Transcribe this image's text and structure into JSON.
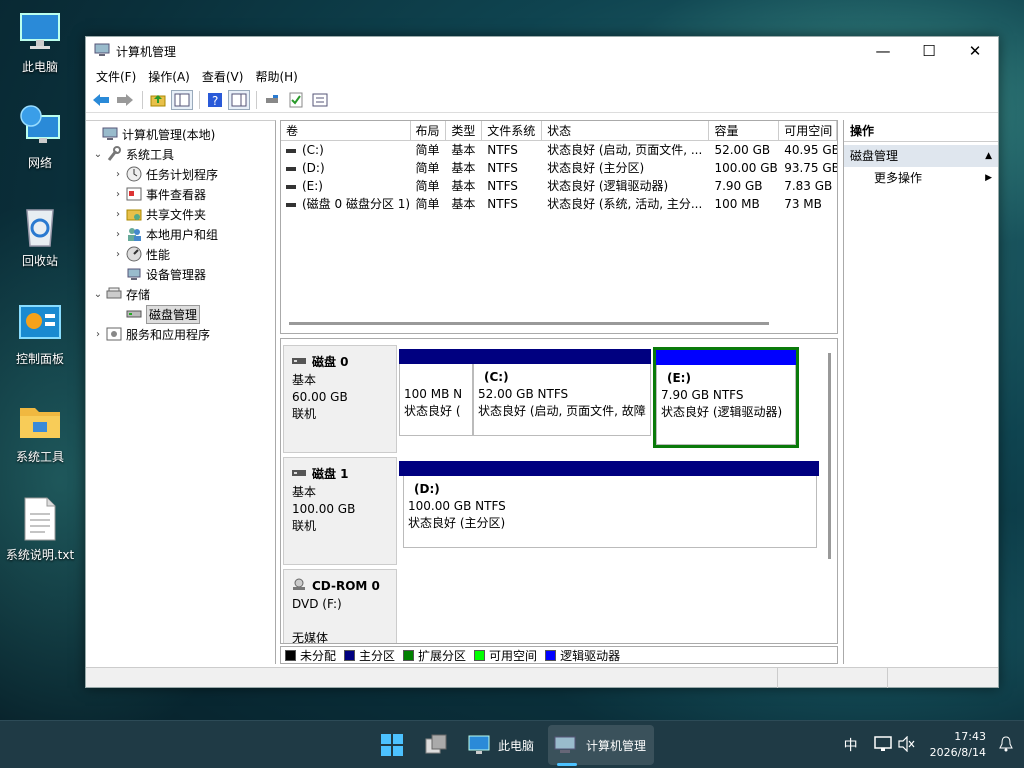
{
  "desktop": {
    "icons": [
      {
        "label": "此电脑"
      },
      {
        "label": "网络"
      },
      {
        "label": "回收站"
      },
      {
        "label": "控制面板"
      },
      {
        "label": "系统工具"
      },
      {
        "label": "系统说明.txt"
      }
    ]
  },
  "window": {
    "title": "计算机管理",
    "controls": {
      "minimize": "—",
      "maximize": "☐",
      "close": "✕"
    },
    "menu": [
      "文件(F)",
      "操作(A)",
      "查看(V)",
      "帮助(H)"
    ]
  },
  "tree": {
    "root": "计算机管理(本地)",
    "system_tools": "系统工具",
    "task_scheduler": "任务计划程序",
    "event_viewer": "事件查看器",
    "shared_folders": "共享文件夹",
    "local_users": "本地用户和组",
    "performance": "性能",
    "device_manager": "设备管理器",
    "storage": "存储",
    "disk_management": "磁盘管理",
    "services_apps": "服务和应用程序"
  },
  "volumes": {
    "headers": [
      "卷",
      "布局",
      "类型",
      "文件系统",
      "状态",
      "容量",
      "可用空间"
    ],
    "rows": [
      [
        "(C:)",
        "简单",
        "基本",
        "NTFS",
        "状态良好 (启动, 页面文件, ...",
        "52.00 GB",
        "40.95 GB"
      ],
      [
        "(D:)",
        "简单",
        "基本",
        "NTFS",
        "状态良好 (主分区)",
        "100.00 GB",
        "93.75 GB"
      ],
      [
        "(E:)",
        "简单",
        "基本",
        "NTFS",
        "状态良好 (逻辑驱动器)",
        "7.90 GB",
        "7.83 GB"
      ],
      [
        "(磁盘 0 磁盘分区 1)",
        "简单",
        "基本",
        "NTFS",
        "状态良好 (系统, 活动, 主分...",
        "100 MB",
        "73 MB"
      ]
    ]
  },
  "disks": [
    {
      "name": "磁盘 0",
      "type": "基本",
      "size": "60.00 GB",
      "state": "联机",
      "partitions": [
        {
          "title": "",
          "size": "100 MB N",
          "status": "状态良好 (",
          "bar_color": "#000080"
        },
        {
          "title": "(C:)",
          "size": "52.00 GB NTFS",
          "status": "状态良好 (启动, 页面文件, 故障",
          "bar_color": "#000080"
        },
        {
          "title": "(E:)",
          "size": "7.90 GB NTFS",
          "status": "状态良好 (逻辑驱动器)",
          "bar_color": "#0000ff"
        }
      ]
    },
    {
      "name": "磁盘 1",
      "type": "基本",
      "size": "100.00 GB",
      "state": "联机",
      "partitions": [
        {
          "title": "(D:)",
          "size": "100.00 GB NTFS",
          "status": "状态良好 (主分区)",
          "bar_color": "#000080"
        }
      ]
    },
    {
      "name": "CD-ROM 0",
      "type": "DVD (F:)",
      "size": "",
      "state": "无媒体",
      "partitions": []
    }
  ],
  "legend": [
    {
      "label": "未分配",
      "color": "#000000"
    },
    {
      "label": "主分区",
      "color": "#000080"
    },
    {
      "label": "扩展分区",
      "color": "#008000"
    },
    {
      "label": "可用空间",
      "color": "#00ff00"
    },
    {
      "label": "逻辑驱动器",
      "color": "#0000ff"
    }
  ],
  "actions": {
    "header": "操作",
    "section": "磁盘管理",
    "more": "更多操作"
  },
  "taskbar": {
    "apps": [
      {
        "label": "此电脑"
      },
      {
        "label": "计算机管理"
      }
    ],
    "ime": "中",
    "time": "17:43",
    "date": "2026/8/14"
  }
}
